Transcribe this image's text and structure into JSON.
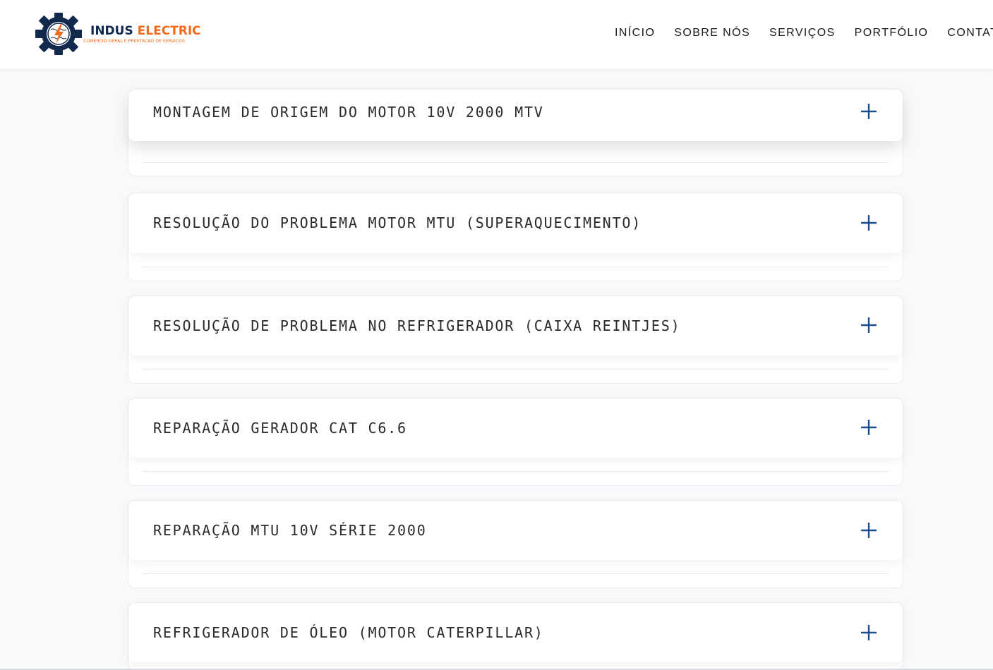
{
  "brand": {
    "name_part1": "INDUS",
    "name_part2": "ELECTRIC",
    "tagline": "COMERCIO GERAL E PRESTACAO DE SERVICOS",
    "logo_icon": "gear-lightning-icon",
    "colors": {
      "navy": "#10294d",
      "orange": "#f26a1b"
    }
  },
  "nav": {
    "items": [
      {
        "label": "INÍCIO"
      },
      {
        "label": "SOBRE NÓS"
      },
      {
        "label": "SERVIÇOS"
      },
      {
        "label": "PORTFÓLIO"
      },
      {
        "label": "CONTATO"
      }
    ]
  },
  "accordion": {
    "expand_icon": "plus-icon",
    "accent_color": "#1d4e8f",
    "items": [
      {
        "title": "MONTAGEM DE ORIGEM DO MOTOR 10V 2000 MTV"
      },
      {
        "title": "RESOLUÇÃO DO PROBLEMA MOTOR MTU (SUPERAQUECIMENTO)"
      },
      {
        "title": "RESOLUÇÃO DE PROBLEMA NO REFRIGERADOR (CAIXA REINTJES)"
      },
      {
        "title": "REPARAÇÃO GERADOR CAT C6.6"
      },
      {
        "title": "REPARAÇÃO MTU 10V SÉRIE 2000"
      },
      {
        "title": "REFRIGERADOR DE ÓLEO (MOTOR CATERPILLAR)"
      }
    ]
  }
}
